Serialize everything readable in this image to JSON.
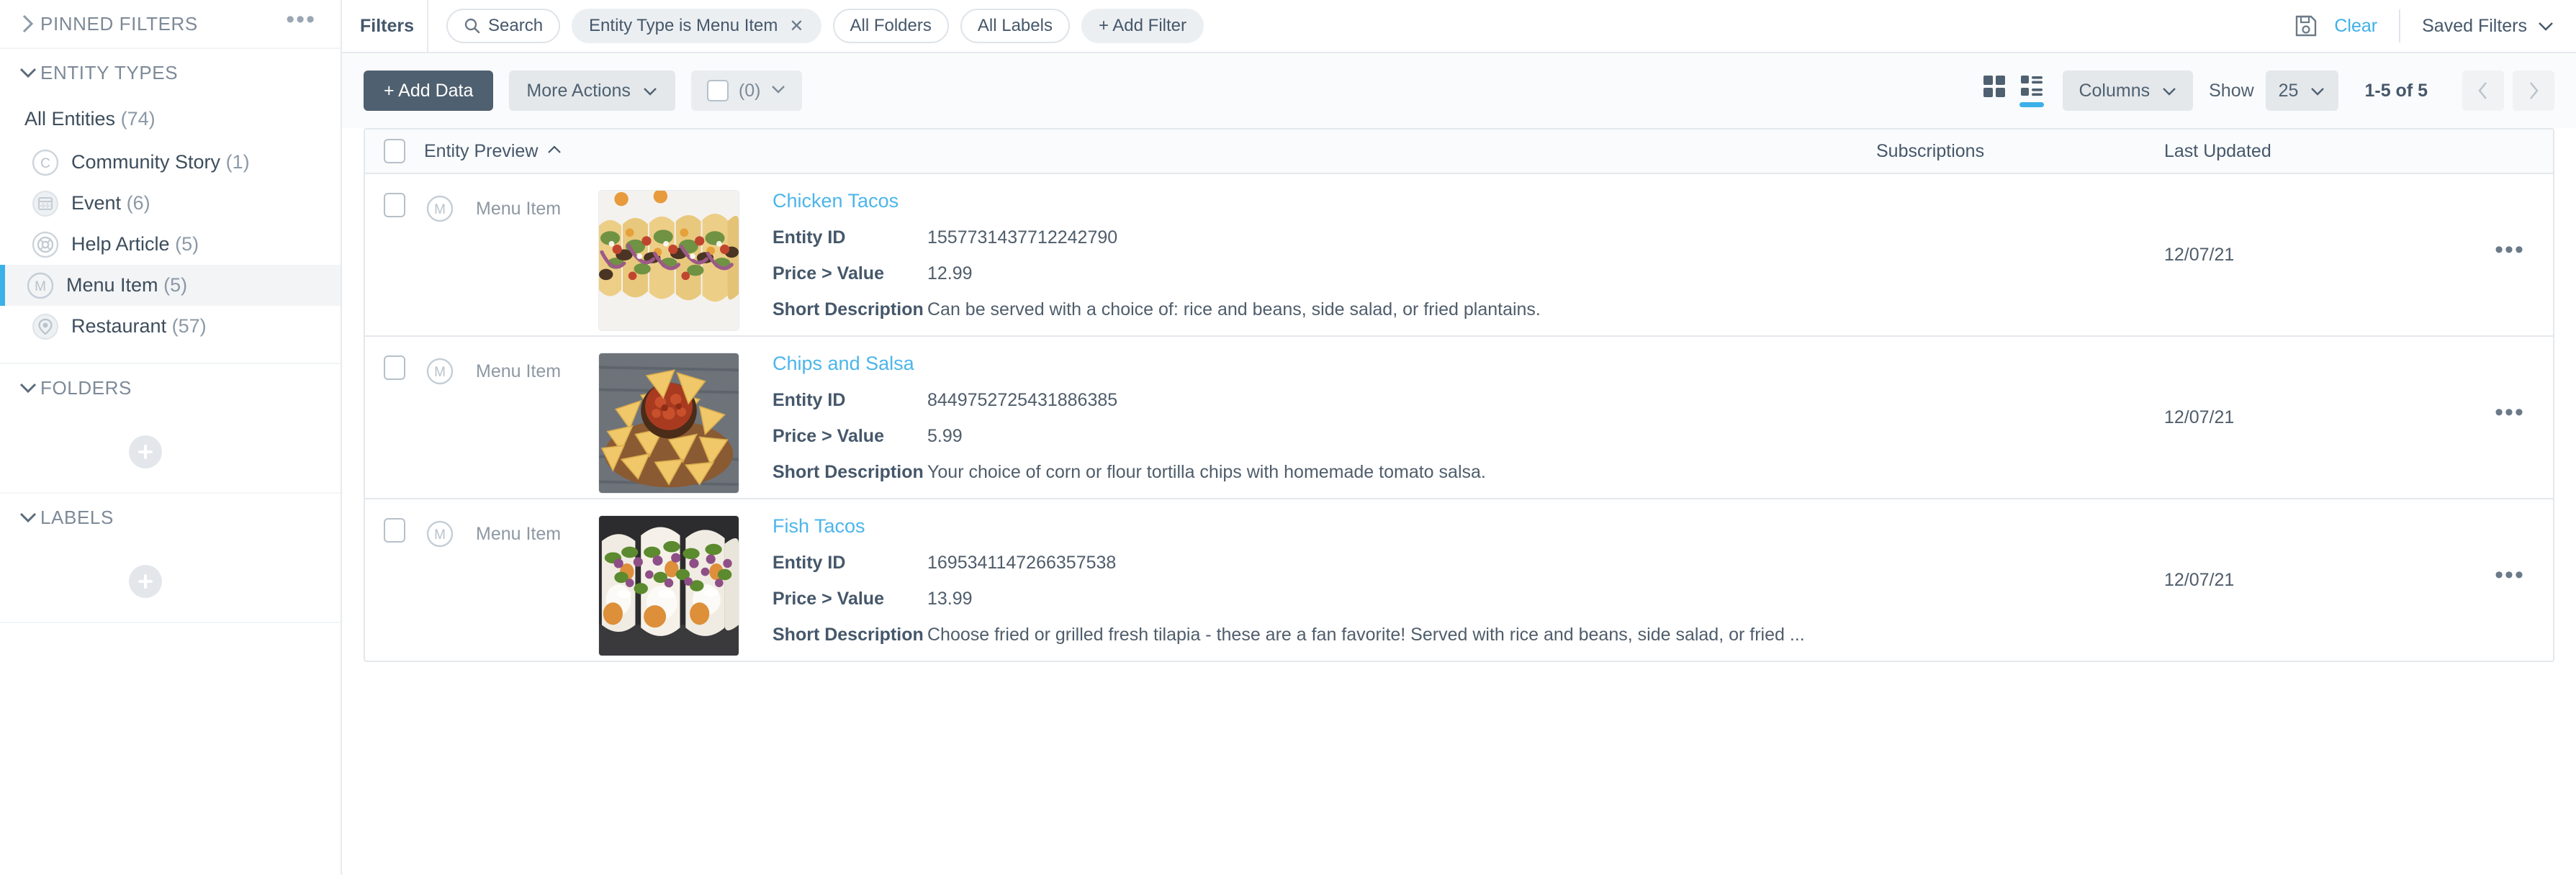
{
  "sidebar": {
    "pinned": {
      "title": "PINNED FILTERS",
      "menu_glyph": "•••"
    },
    "entity_types": {
      "title": "ENTITY TYPES",
      "all_label": "All Entities",
      "all_count": "(74)",
      "items": [
        {
          "label": "Community Story",
          "count": "(1)",
          "icon": "community-story-icon",
          "active": false
        },
        {
          "label": "Event",
          "count": "(6)",
          "icon": "event-icon",
          "active": false
        },
        {
          "label": "Help Article",
          "count": "(5)",
          "icon": "help-article-icon",
          "active": false
        },
        {
          "label": "Menu Item",
          "count": "(5)",
          "icon": "menu-item-icon",
          "active": true
        },
        {
          "label": "Restaurant",
          "count": "(57)",
          "icon": "restaurant-icon",
          "active": false
        }
      ]
    },
    "folders": {
      "title": "FOLDERS",
      "add_label": "+"
    },
    "labels": {
      "title": "LABELS",
      "add_label": "+"
    }
  },
  "filterbar": {
    "label": "Filters",
    "chips": [
      {
        "text": "Search",
        "icon": "search-icon",
        "style": "outline",
        "removable": false
      },
      {
        "text": "Entity Type is Menu Item",
        "icon": "",
        "style": "solid",
        "removable": true,
        "remove_glyph": "✕"
      },
      {
        "text": "All Folders",
        "icon": "",
        "style": "outline",
        "removable": false
      },
      {
        "text": "All Labels",
        "icon": "",
        "style": "outline",
        "removable": false
      },
      {
        "text": "+ Add Filter",
        "icon": "",
        "style": "solid",
        "removable": false
      }
    ],
    "save_icon": "save-icon",
    "clear_label": "Clear",
    "saved_filters_label": "Saved Filters"
  },
  "toolbar": {
    "add_data_label": "+ Add Data",
    "more_actions_label": "More Actions",
    "selected_count": "(0)",
    "grid_view_icon": "grid-view-icon",
    "list_view_icon": "list-view-icon",
    "active_view": "list",
    "columns_label": "Columns",
    "show_label": "Show",
    "page_size": "25",
    "range_label": "1-5 of 5",
    "prev_glyph": "‹",
    "next_glyph": "›"
  },
  "table": {
    "columns": {
      "entity_preview": "Entity Preview",
      "sort_glyph": "⌃",
      "subscriptions": "Subscriptions",
      "last_updated": "Last Updated"
    },
    "field_labels": {
      "entity_id": "Entity ID",
      "price_value": "Price > Value",
      "short_description": "Short Description"
    },
    "rows": [
      {
        "entity_type": "Menu Item",
        "entity_type_icon": "menu-item-icon",
        "thumbnail": "chicken-tacos-photo",
        "name": "Chicken Tacos",
        "entity_id": "1557731437712242790",
        "price": "12.99",
        "description": "Can be served with a choice of: rice and beans, side salad, or fried plantains.",
        "subscriptions": "",
        "last_updated": "12/07/21",
        "menu_glyph": "•••"
      },
      {
        "entity_type": "Menu Item",
        "entity_type_icon": "menu-item-icon",
        "thumbnail": "chips-and-salsa-photo",
        "name": "Chips and Salsa",
        "entity_id": "8449752725431886385",
        "price": "5.99",
        "description": "Your choice of corn or flour tortilla chips with homemade tomato salsa.",
        "subscriptions": "",
        "last_updated": "12/07/21",
        "menu_glyph": "•••"
      },
      {
        "entity_type": "Menu Item",
        "entity_type_icon": "menu-item-icon",
        "thumbnail": "fish-tacos-photo",
        "name": "Fish Tacos",
        "entity_id": "1695341147266357538",
        "price": "13.99",
        "description": "Choose fried or grilled fresh tilapia - these are a fan favorite! Served with rice and beans, side salad, or fried ...",
        "subscriptions": "",
        "last_updated": "12/07/21",
        "menu_glyph": "•••"
      }
    ]
  },
  "colors": {
    "accent_blue": "#3cb0e8",
    "link_blue": "#4cb5ea",
    "primary_button": "#4f6070",
    "text_dark": "#45576a",
    "text_muted": "#8b99a6"
  }
}
